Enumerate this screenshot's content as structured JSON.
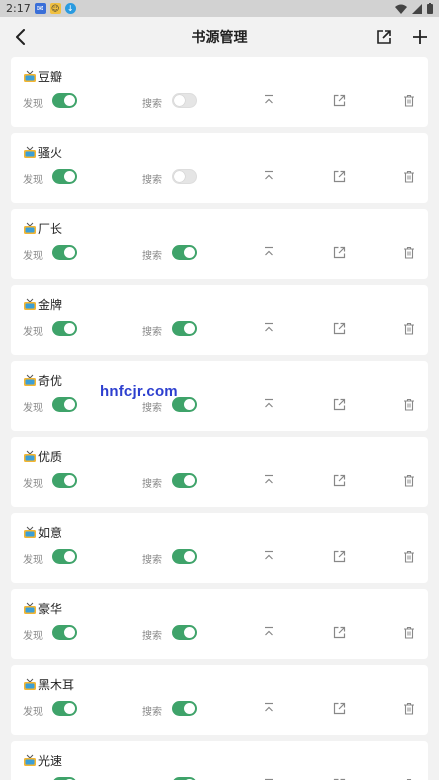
{
  "status_bar": {
    "time": "2:17"
  },
  "header": {
    "title": "书源管理"
  },
  "label_discover": "发现",
  "label_search": "搜索",
  "watermark": "hnfcjr.com",
  "sources": [
    {
      "name": "豆瓣",
      "discover": true,
      "search": false
    },
    {
      "name": "骚火",
      "discover": true,
      "search": false
    },
    {
      "name": "厂长",
      "discover": true,
      "search": true
    },
    {
      "name": "金牌",
      "discover": true,
      "search": true
    },
    {
      "name": "奇优",
      "discover": true,
      "search": true
    },
    {
      "name": "优质",
      "discover": true,
      "search": true
    },
    {
      "name": "如意",
      "discover": true,
      "search": true
    },
    {
      "name": "豪华",
      "discover": true,
      "search": true
    },
    {
      "name": "黑木耳",
      "discover": true,
      "search": true
    },
    {
      "name": "光速",
      "discover": true,
      "search": true
    }
  ],
  "icons": {
    "back": "back-arrow-icon",
    "share": "share-icon",
    "add": "plus-icon",
    "top": "move-top-icon",
    "open": "open-external-icon",
    "delete": "trash-icon",
    "source": "tv-icon"
  },
  "colors": {
    "accent": "#3fa36a",
    "toggle_off": "#e5e5e5",
    "background": "#f2f2f2",
    "card": "#ffffff"
  }
}
